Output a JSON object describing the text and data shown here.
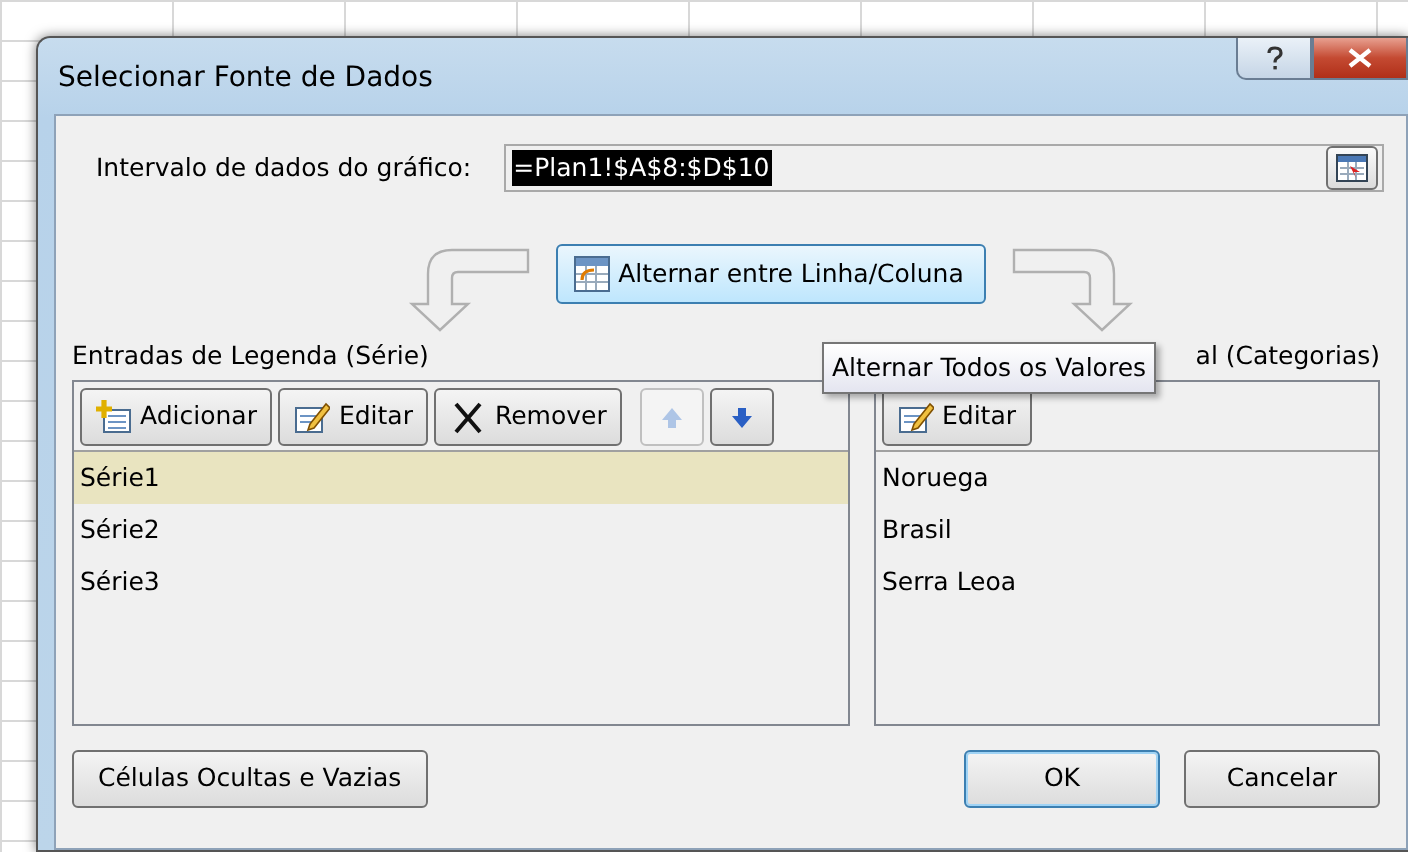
{
  "window": {
    "title": "Selecionar Fonte de Dados"
  },
  "data_range": {
    "label": "Intervalo de dados do gráfico:",
    "value": "=Plan1!$A$8:$D$10",
    "selected": true
  },
  "switch_button": {
    "label": "Alternar entre Linha/Coluna"
  },
  "tooltip": {
    "text": "Alternar Todos os Valores"
  },
  "legend_entries": {
    "title": "Entradas de Legenda (Série)",
    "buttons": [
      {
        "kind": "add",
        "label": "Adicionar",
        "disabled": false
      },
      {
        "kind": "edit",
        "label": "Editar",
        "disabled": false
      },
      {
        "kind": "remove",
        "label": "Remover",
        "disabled": false
      },
      {
        "kind": "up",
        "disabled": true
      },
      {
        "kind": "down",
        "disabled": false
      }
    ],
    "items": [
      {
        "label": "Série1",
        "selected": true
      },
      {
        "label": "Série2",
        "selected": false
      },
      {
        "label": "Série3",
        "selected": false
      }
    ]
  },
  "axis_labels": {
    "title": "al (Categorias)",
    "buttons": [
      {
        "kind": "edit",
        "label": "Editar",
        "disabled": false
      }
    ],
    "items": [
      {
        "label": "Noruega",
        "selected": false
      },
      {
        "label": "Brasil",
        "selected": false
      },
      {
        "label": "Serra Leoa",
        "selected": false
      }
    ]
  },
  "footer": {
    "buttons": [
      {
        "label": "Células Ocultas e Vazias",
        "default": false
      },
      {
        "label": "OK",
        "default": true
      },
      {
        "label": "Cancelar",
        "default": false
      }
    ]
  }
}
